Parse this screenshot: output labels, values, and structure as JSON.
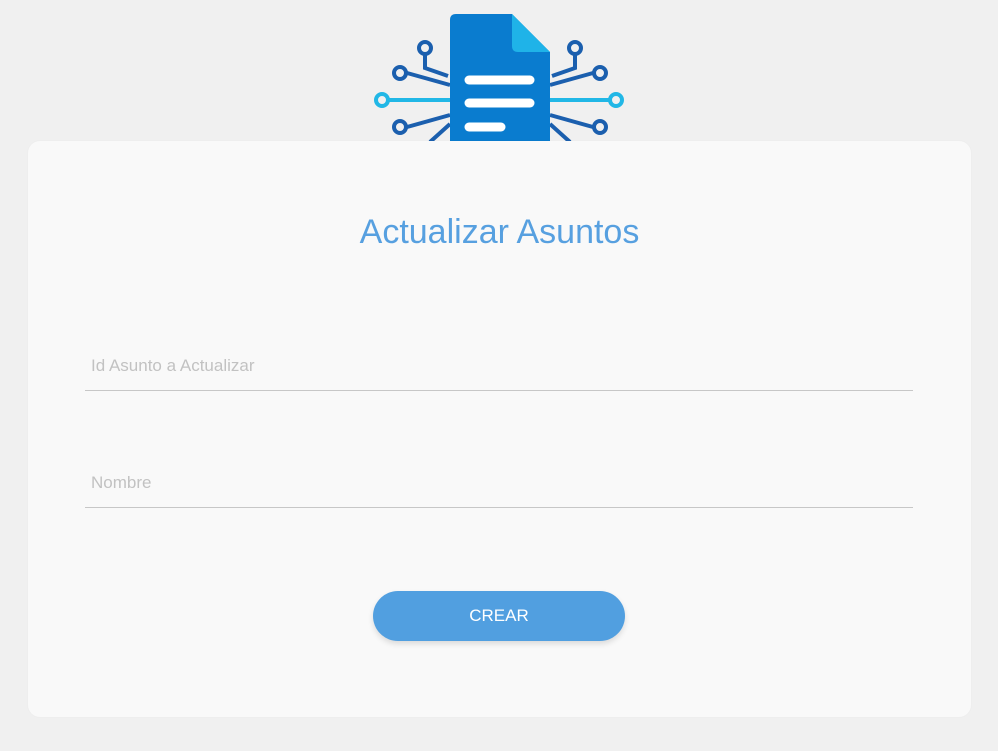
{
  "logo": {
    "icon": "document-circuit-icon"
  },
  "form": {
    "title": "Actualizar Asuntos",
    "id_field": {
      "placeholder": "Id Asunto a Actualizar",
      "value": ""
    },
    "name_field": {
      "placeholder": "Nombre",
      "value": ""
    },
    "submit_label": "CREAR"
  },
  "colors": {
    "accent": "#519fe0",
    "title": "#57a0e0",
    "doc_dark": "#0a7ccf",
    "doc_light": "#1fb3e8",
    "circuit_dark": "#1b5fae",
    "circuit_light": "#21b7e6",
    "background": "#f0f0f0",
    "card": "#f9f9f9"
  }
}
